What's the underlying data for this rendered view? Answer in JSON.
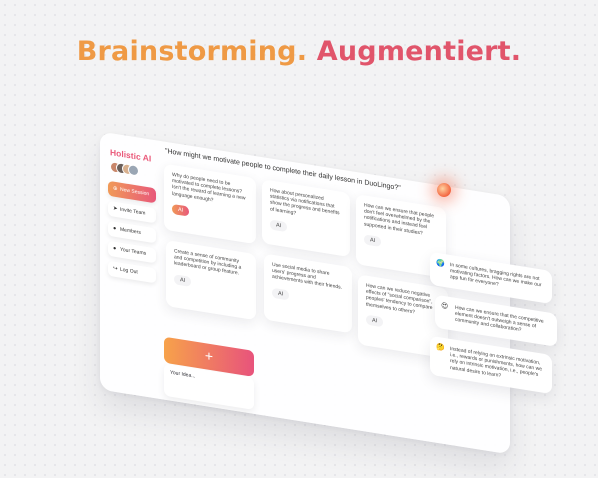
{
  "hero": {
    "part1": "Brainstorming.",
    "part2": "Augmentiert."
  },
  "brand": "Holistic AI",
  "nav": [
    {
      "label": "New Session",
      "icon": "plus-icon",
      "active": true
    },
    {
      "label": "Invite Team",
      "icon": "send-icon"
    },
    {
      "label": "Members",
      "icon": "user-icon"
    },
    {
      "label": "Your Teams",
      "icon": "team-icon"
    },
    {
      "label": "Log Out",
      "icon": "logout-icon"
    }
  ],
  "question": "\"How might we motivate people to complete their daily lesson in DuoLingo?\"",
  "cards": [
    {
      "text": "Why do people need to be motivated to complete lessons? Isn't the reward of learning a new language enough?",
      "ai": "AI",
      "highlight": true
    },
    {
      "text": "How about personalized statistics via notifications that show the progress and benefits of learning?",
      "ai": "AI"
    },
    {
      "text": "How can we ensure that people don't feel overwhelmed by the notifications and instead feel supported in their studies?",
      "ai": "AI"
    },
    {
      "text": "Create a sense of community and competition by including a leaderboard or group feature.",
      "ai": "AI"
    },
    {
      "text": "Use social media to share users' progress and achievements with their friends.",
      "ai": "AI"
    },
    {
      "text": "How can we reduce negative effects of \"social comparison\", peoples' tendency to compare themselves to others?",
      "ai": "AI"
    }
  ],
  "add_button": "+",
  "idea_placeholder": "Your Idea...",
  "suggestions": [
    {
      "emoji": "🌍",
      "text": "In some cultures, bragging rights are not motivating factors. How can we make our app fun for everyone?"
    },
    {
      "emoji": "😍",
      "text": "How can we ensure that the competitive element doesn't outweigh a sense of community and collaboration?"
    },
    {
      "emoji": "🤔",
      "text": "Instead of relying on extrinsic motivation, i.e., rewards or punishments, how can we rely on intrinsic motivation, i.e., people's natural desire to learn?"
    }
  ]
}
